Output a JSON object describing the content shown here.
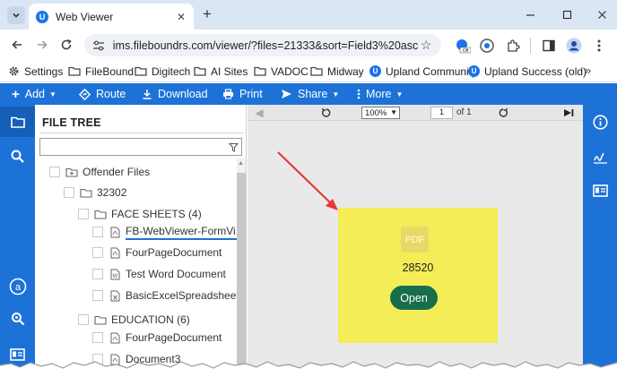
{
  "browser": {
    "tab_title": "Web Viewer",
    "favicon_letter": "U",
    "url": "ims.fileboundrs.com/viewer/?files=21333&sort=Field3%20asc",
    "bookmarks": [
      "Settings",
      "FileBound",
      "Digitech",
      "AI Sites",
      "VADOC",
      "Midway",
      "Upland Community",
      "Upland Success (old)"
    ]
  },
  "app_toolbar": {
    "add": "Add",
    "route": "Route",
    "download": "Download",
    "print": "Print",
    "share": "Share",
    "more": "More"
  },
  "file_tree": {
    "title": "FILE TREE",
    "search_value": "",
    "nodes": [
      {
        "label": "Offender Files",
        "type": "folder-root"
      },
      {
        "label": "32302",
        "type": "folder"
      },
      {
        "label": "FACE SHEETS (4)",
        "type": "folder"
      },
      {
        "label": "FB-WebViewer-FormVi...",
        "type": "pdf",
        "selected": true
      },
      {
        "label": "FourPageDocument",
        "type": "pdf"
      },
      {
        "label": "Test Word Document",
        "type": "word"
      },
      {
        "label": "BasicExcelSpreadsheet",
        "type": "excel"
      },
      {
        "label": "EDUCATION (6)",
        "type": "folder"
      },
      {
        "label": "FourPageDocument",
        "type": "pdf"
      },
      {
        "label": "Document3",
        "type": "pdf"
      }
    ]
  },
  "viewer": {
    "zoom": "100%",
    "page_current": "1",
    "page_total": "of 1",
    "card": {
      "icon_text": "PDF",
      "document_id": "28520",
      "open_label": "Open",
      "background": "#f4ed58",
      "button_color": "#166e4d"
    }
  },
  "colors": {
    "accent": "#1d72d8",
    "annotation_arrow": "#e53935"
  }
}
